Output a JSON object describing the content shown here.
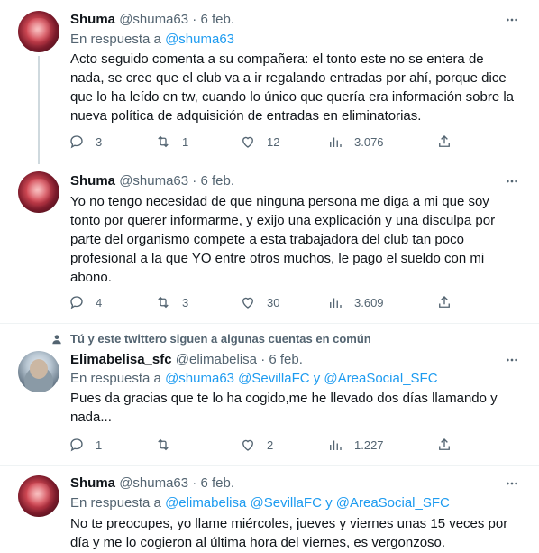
{
  "tweets": [
    {
      "name": "Shuma",
      "handle": "@shuma63",
      "date": "6 feb.",
      "reply_prefix": "En respuesta a",
      "reply_mentions": "@shuma63",
      "text": "Acto seguido comenta a su compañera: el tonto este no se entera de nada, se cree que el club va a ir regalando entradas por ahí, porque dice que lo ha leído en tw, cuando lo único que quería era información sobre la nueva política de adquisición de entradas en eliminatorias.",
      "replies": "3",
      "retweets": "1",
      "likes": "12",
      "views": "3.076"
    },
    {
      "name": "Shuma",
      "handle": "@shuma63",
      "date": "6 feb.",
      "text": "Yo no tengo necesidad de que ninguna persona me diga a mi que soy tonto por querer informarme, y exijo una explicación y una disculpa por parte del organismo compete a esta trabajadora del club tan poco profesional a la que YO entre otros muchos, le pago el sueldo con mi abono.",
      "replies": "4",
      "retweets": "3",
      "likes": "30",
      "views": "3.609"
    },
    {
      "social_context": "Tú y este twittero siguen a algunas cuentas en común",
      "name": "Elimabelisa_sfc",
      "handle": "@elimabelisa",
      "date": "6 feb.",
      "reply_prefix": "En respuesta a",
      "reply_mentions": "@shuma63 @SevillaFC y @AreaSocial_SFC",
      "text": "Pues da gracias que te lo ha cogido,me he llevado dos días llamando y nada...",
      "replies": "1",
      "retweets": "",
      "likes": "2",
      "views": "1.227"
    },
    {
      "name": "Shuma",
      "handle": "@shuma63",
      "date": "6 feb.",
      "reply_prefix": "En respuesta a",
      "reply_mentions": "@elimabelisa @SevillaFC y @AreaSocial_SFC",
      "text": "No te preocupes, yo llame miércoles, jueves y viernes unas 15 veces por día y me lo cogieron al última hora del viernes, es vergonzoso."
    }
  ],
  "separator": "·",
  "icons": {
    "more": "more-horizontal-icon",
    "reply": "reply-icon",
    "retweet": "retweet-icon",
    "like": "heart-icon",
    "views": "views-icon",
    "share": "share-icon",
    "social": "person-icon"
  },
  "colors": {
    "accent": "#1d9bf0",
    "secondary_text": "#536471",
    "primary_text": "#0f1419",
    "divider": "#eff3f4"
  }
}
